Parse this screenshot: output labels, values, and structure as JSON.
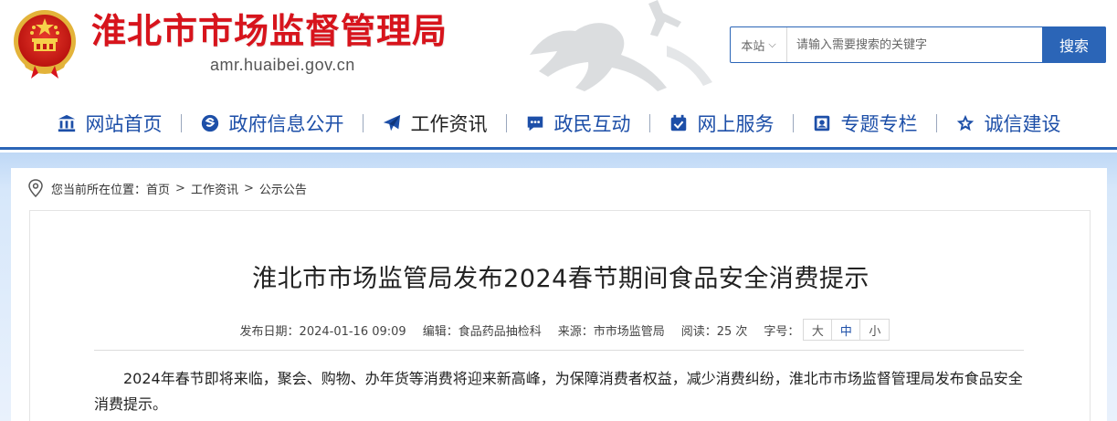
{
  "site": {
    "title": "淮北市市场监督管理局",
    "domain": "amr.huaibei.gov.cn"
  },
  "search": {
    "scope": "本站",
    "placeholder": "请输入需要搜索的关键字",
    "button": "搜索"
  },
  "nav": {
    "items": [
      {
        "label": "网站首页",
        "icon": "bank-icon"
      },
      {
        "label": "政府信息公开",
        "icon": "globe-e-icon"
      },
      {
        "label": "工作资讯",
        "icon": "paper-plane-icon"
      },
      {
        "label": "政民互动",
        "icon": "chat-icon"
      },
      {
        "label": "网上服务",
        "icon": "calendar-check-icon"
      },
      {
        "label": "专题专栏",
        "icon": "image-badge-icon"
      },
      {
        "label": "诚信建设",
        "icon": "star-icon"
      }
    ],
    "active_index": 2
  },
  "breadcrumb": {
    "prefix": "您当前所在位置：",
    "items": [
      "首页",
      "工作资讯",
      "公示公告"
    ],
    "separator": ">"
  },
  "article": {
    "title": "淮北市市场监管局发布2024春节期间食品安全消费提示",
    "meta": {
      "date": "发布日期：2024-01-16 09:09",
      "editor": "编辑：食品药品抽检科",
      "source": "来源：市市场监管局",
      "reads": "阅读：25 次",
      "fontsize_label": "字号："
    },
    "fontsize_options": [
      "大",
      "中",
      "小"
    ],
    "paragraph": "2024年春节即将来临，聚会、购物、办年货等消费将迎来新高峰，为保障消费者权益，减少消费纠纷，淮北市市场监督管理局发布食品安全消费提示。"
  },
  "colors": {
    "brand_red": "#d7141c",
    "brand_blue": "#2b65b7",
    "nav_text": "#1d4fa8"
  }
}
